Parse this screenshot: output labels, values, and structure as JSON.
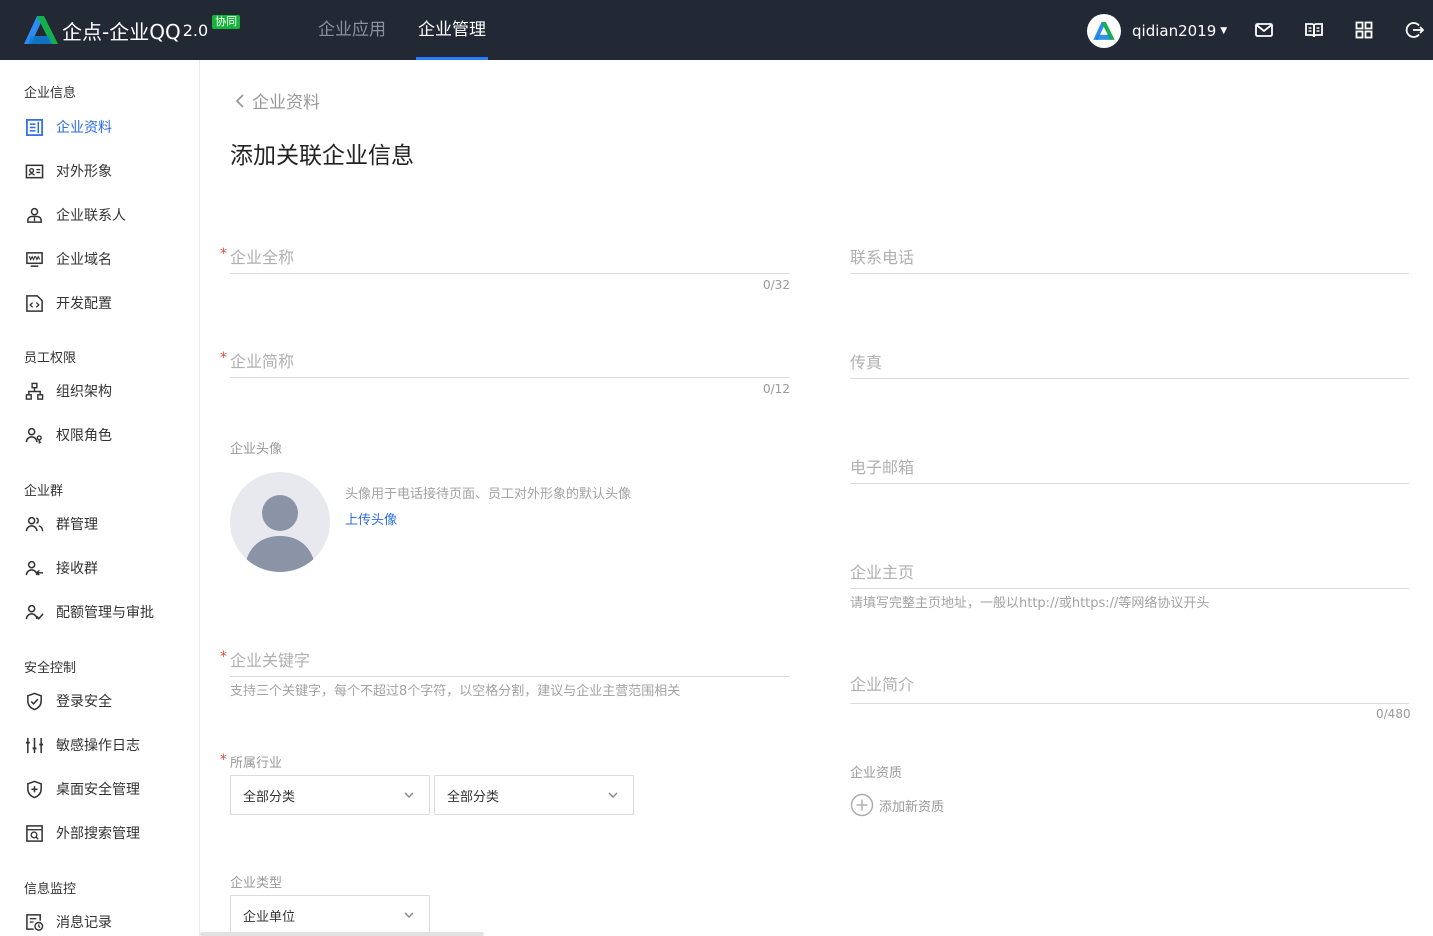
{
  "header": {
    "brand": "企点-企业QQ",
    "version": "2.0",
    "badge": "协同",
    "tabs": [
      {
        "label": "企业应用",
        "active": false
      },
      {
        "label": "企业管理",
        "active": true
      }
    ],
    "user_name": "qidian2019",
    "icons": [
      "mail-icon",
      "book-icon",
      "grid-icon",
      "logout-icon"
    ]
  },
  "sidebar": {
    "groups": [
      {
        "title": "企业信息",
        "items": [
          {
            "label": "企业资料",
            "icon": "profile-icon",
            "active": true
          },
          {
            "label": "对外形象",
            "icon": "id-card-icon"
          },
          {
            "label": "企业联系人",
            "icon": "contact-icon"
          },
          {
            "label": "企业域名",
            "icon": "domain-icon"
          },
          {
            "label": "开发配置",
            "icon": "code-icon"
          }
        ]
      },
      {
        "title": "员工权限",
        "items": [
          {
            "label": "组织架构",
            "icon": "org-chart-icon"
          },
          {
            "label": "权限角色",
            "icon": "role-icon"
          }
        ]
      },
      {
        "title": "企业群",
        "items": [
          {
            "label": "群管理",
            "icon": "group-icon"
          },
          {
            "label": "接收群",
            "icon": "receive-group-icon"
          },
          {
            "label": "配额管理与审批",
            "icon": "quota-icon"
          }
        ]
      },
      {
        "title": "安全控制",
        "items": [
          {
            "label": "登录安全",
            "icon": "shield-check-icon"
          },
          {
            "label": "敏感操作日志",
            "icon": "sliders-icon"
          },
          {
            "label": "桌面安全管理",
            "icon": "shield-plus-icon"
          },
          {
            "label": "外部搜索管理",
            "icon": "search-box-icon"
          }
        ]
      },
      {
        "title": "信息监控",
        "items": [
          {
            "label": "消息记录",
            "icon": "message-log-icon"
          }
        ]
      }
    ]
  },
  "main": {
    "back_label": "企业资料",
    "title": "添加关联企业信息",
    "form": {
      "full_name": {
        "label": "企业全称",
        "counter": "0/32",
        "required": true
      },
      "short_name": {
        "label": "企业简称",
        "counter": "0/12",
        "required": true
      },
      "avatar": {
        "label": "企业头像",
        "hint": "头像用于电话接待页面、员工对外形象的默认头像",
        "upload_label": "上传头像"
      },
      "keywords": {
        "label": "企业关键字",
        "hint": "支持三个关键字，每个不超过8个字符，以空格分割，建议与企业主营范围相关",
        "required": true
      },
      "industry": {
        "label": "所属行业",
        "select1": "全部分类",
        "select2": "全部分类",
        "required": true
      },
      "company_type": {
        "label": "企业类型",
        "value": "企业单位"
      },
      "phone": {
        "label": "联系电话"
      },
      "fax": {
        "label": "传真"
      },
      "email": {
        "label": "电子邮箱"
      },
      "homepage": {
        "label": "企业主页",
        "hint": "请填写完整主页地址，一般以http://或https://等网络协议开头"
      },
      "intro": {
        "label": "企业简介",
        "counter": "0/480"
      },
      "qualification": {
        "label": "企业资质",
        "add_label": "添加新资质"
      }
    }
  },
  "colors": {
    "topbar": "#222834",
    "accent": "#2b6dde",
    "required": "#e84a3a",
    "badge": "#15b33a"
  }
}
